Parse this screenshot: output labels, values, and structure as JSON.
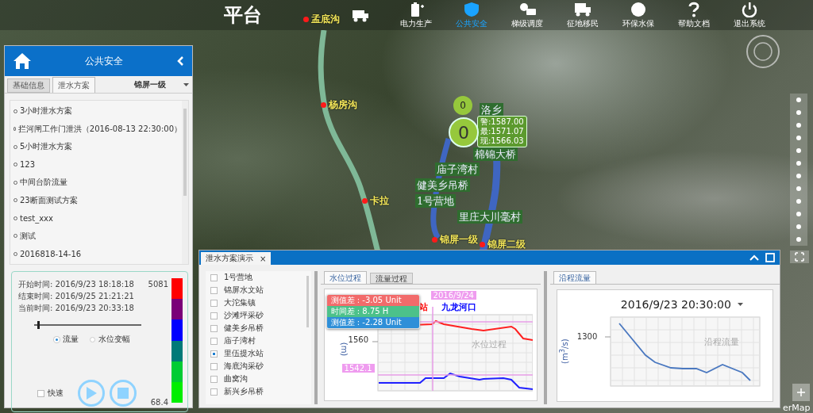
{
  "top_bar": {
    "title": "平台",
    "nav": [
      {
        "selected": false
      },
      {
        "label": "电力生产",
        "selected": false
      },
      {
        "label": "公共安全",
        "selected": true
      },
      {
        "label": "梯级调度",
        "selected": false
      },
      {
        "label": "征地移民",
        "selected": false
      },
      {
        "label": "环保水保",
        "selected": false
      },
      {
        "label": "帮助文档",
        "selected": false
      },
      {
        "label": "退出系统",
        "selected": false
      }
    ]
  },
  "map": {
    "places": [
      {
        "name": "孟底沟"
      },
      {
        "name": "杨房沟"
      },
      {
        "name": "卡拉"
      },
      {
        "name": "锦屏一级"
      },
      {
        "name": "锦屏二级"
      }
    ],
    "village_labels": [
      "洛乡",
      "棉锦大桥",
      "庙子湾村",
      "健美乡吊桥",
      "1号营地",
      "里庄大川毫村"
    ],
    "gauge": {
      "small_count": "0",
      "count": "0",
      "readings": [
        "警:1587.00",
        "最:1571.07",
        "现:1566.03"
      ]
    },
    "attribution": "erMap"
  },
  "left_panel": {
    "title": "公共安全",
    "tabs": [
      {
        "label": "基础信息",
        "selected": false
      },
      {
        "label": "泄水方案",
        "selected": true
      }
    ],
    "station_select": "锦屏一级",
    "plans": [
      "3小时泄水方案",
      "拦河闸工作门泄洪（2016-08-13 22:30:00）",
      "5小时泄水方案",
      "123",
      "中间台阶流量",
      "23断面测试方案",
      "test_xxx",
      "测试",
      "2016818-14-16"
    ],
    "playback": {
      "start": "开始时间: 2016/9/23 18:18:18",
      "end": "结束时间: 2016/9/25 21:21:21",
      "current": "当前时间: 2016/9/23 20:33:18",
      "level": 0.03,
      "modes": [
        {
          "label": "流量",
          "selected": true
        },
        {
          "label": "水位变幅",
          "selected": false
        }
      ],
      "fast": {
        "label": "快速",
        "checked": false
      },
      "legend": {
        "max": "5081",
        "min": "68.4",
        "colors": [
          {
            "color": "#ff0000"
          },
          {
            "color": "#7a0078"
          },
          {
            "color": "#0000ff"
          },
          {
            "color": "#007a78"
          },
          {
            "color": "#00cc33"
          },
          {
            "color": "#00ee00"
          }
        ]
      }
    }
  },
  "bottom_panel": {
    "tab": "泄水方案演示",
    "close": "×",
    "stations": [
      {
        "label": "1号营地",
        "checked": false
      },
      {
        "label": "锦屏水文站",
        "checked": false
      },
      {
        "label": "大沱集镇",
        "checked": false
      },
      {
        "label": "沙滩坪采砂",
        "checked": false
      },
      {
        "label": "健美乡吊桥",
        "checked": false
      },
      {
        "label": "庙子湾村",
        "checked": false
      },
      {
        "label": "里伍提水站",
        "checked": true
      },
      {
        "label": "海底沟采砂",
        "checked": false
      },
      {
        "label": "曲窝沟",
        "checked": false
      },
      {
        "label": "新兴乡吊桥",
        "checked": false
      }
    ],
    "chart_tabs": [
      {
        "label": "水位过程",
        "selected": true
      },
      {
        "label": "流量过程",
        "selected": false
      }
    ],
    "level_chart": {
      "watermark": "水位过程",
      "ylabel": "(m)",
      "ytick": "1560",
      "cursor_value": "1542.1",
      "cursor_date": "2016/9/24",
      "legend": [
        {
          "label": "站",
          "color": "#ff0000"
        },
        {
          "label": "九龙河口",
          "color": "#0000ff"
        }
      ],
      "tooltip": [
        {
          "text": "测值差 : -3.05 Unit",
          "color": "#f26b6b"
        },
        {
          "text": "时间差 : 8.75 H",
          "color": "#4cc18a"
        },
        {
          "text": "测值差 : -2.28 Unit",
          "color": "#2e8fd8"
        }
      ]
    },
    "flow_tab": "沿程流量",
    "flow_chart": {
      "time": "2016/9/23 20:30:00",
      "ylabel": "(m$^{3}$/s)",
      "ytick": "1300",
      "watermark": "沿程流量"
    }
  }
}
